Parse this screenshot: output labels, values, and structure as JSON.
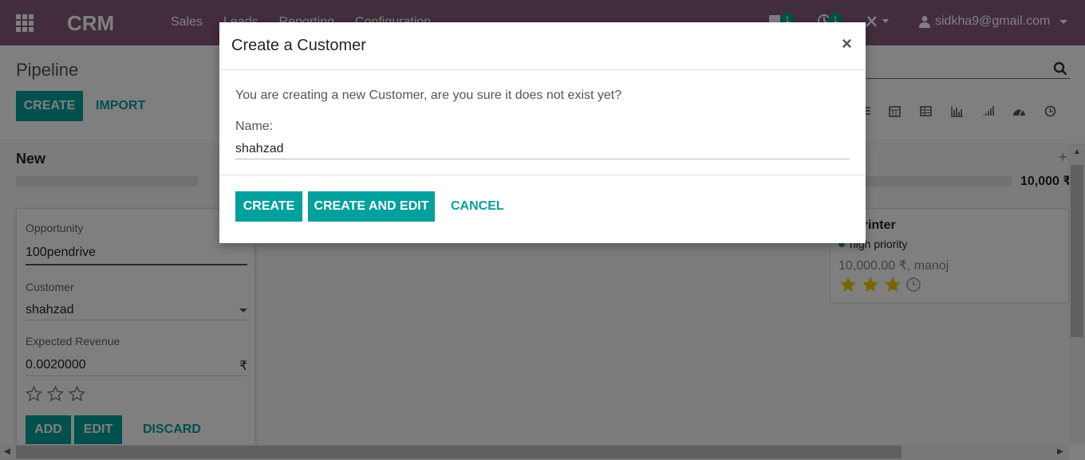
{
  "navbar": {
    "brand": "CRM",
    "menu": [
      "Sales",
      "Leads",
      "Reporting",
      "Configuration"
    ],
    "messages_count": "1",
    "activities_count": "1",
    "user_email": "sidkha9@gmail.com",
    "bg_color": "#875a7b"
  },
  "control_panel": {
    "breadcrumb": "Pipeline",
    "create_label": "CREATE",
    "import_label": "IMPORT"
  },
  "kanban": {
    "column_title": "New",
    "column_total": "10,000 ₹",
    "quick_create": {
      "opportunity_label": "Opportunity",
      "opportunity_value": "100pendrive",
      "customer_label": "Customer",
      "customer_value": "shahzad",
      "revenue_label": "Expected Revenue",
      "revenue_value": "0.0020000",
      "currency": "₹",
      "add_label": "ADD",
      "edit_label": "EDIT",
      "discard_label": "DISCARD"
    },
    "card": {
      "title": "printer",
      "tag": "high priority",
      "revenue": "10,000.00 ₹, manoj"
    }
  },
  "modal": {
    "title": "Create a Customer",
    "close_symbol": "×",
    "message": "You are creating a new Customer, are you sure it does not exist yet?",
    "name_label": "Name:",
    "name_value": "shahzad",
    "create_label": "CREATE",
    "create_edit_label": "CREATE AND EDIT",
    "cancel_label": "CANCEL"
  },
  "colors": {
    "primary": "#00a09d",
    "navbar": "#875a7b",
    "star_filled": "#f3cc00"
  }
}
